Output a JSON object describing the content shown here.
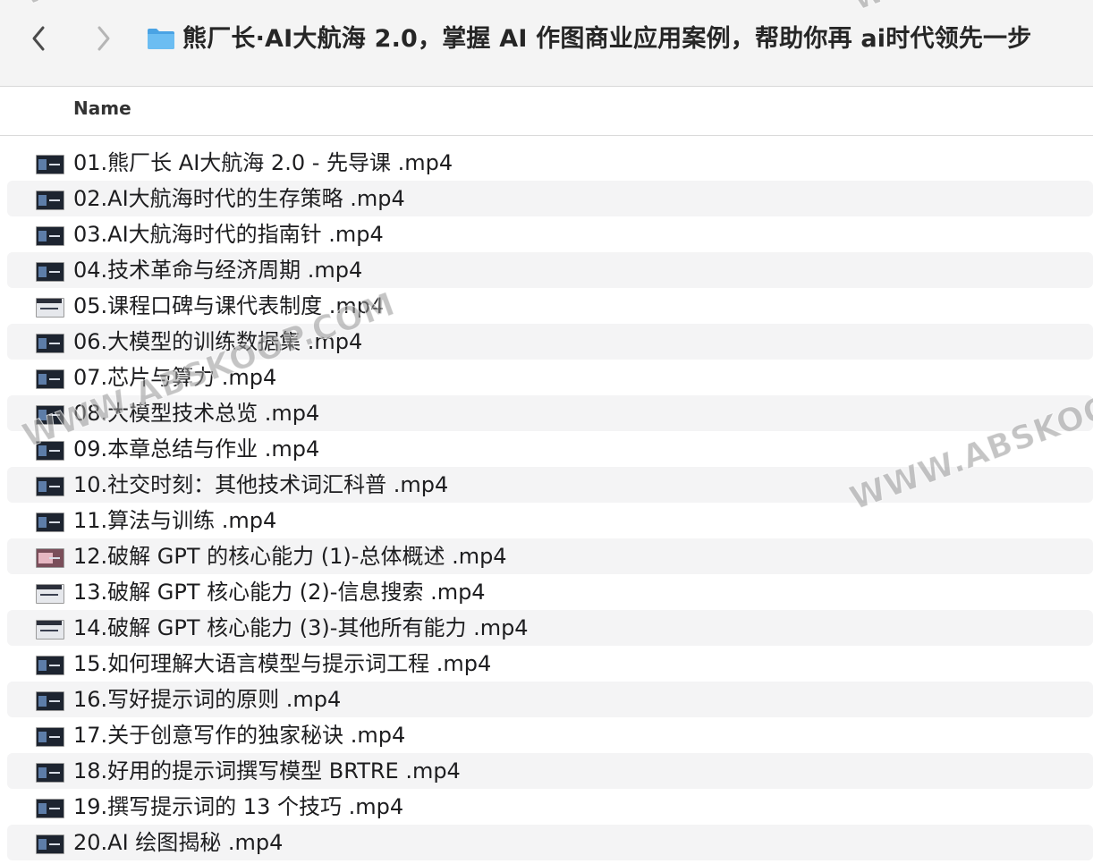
{
  "toolbar": {
    "title": "熊厂长·AI大航海 2.0，掌握 AI 作图商业应用案例，帮助你再 ai时代领先一步",
    "back_icon": "chevron-left-icon",
    "forward_icon": "chevron-right-icon",
    "folder_icon": "folder-icon",
    "folder_color": "#5fb2ec"
  },
  "columns": {
    "name": "Name"
  },
  "files": [
    {
      "name": "01.熊厂长 AI大航海 2.0 - 先导课 .mp4",
      "thumb": "dark"
    },
    {
      "name": "02.AI大航海时代的生存策略 .mp4",
      "thumb": "dark"
    },
    {
      "name": "03.AI大航海时代的指南针 .mp4",
      "thumb": "dark"
    },
    {
      "name": "04.技术革命与经济周期 .mp4",
      "thumb": "dark"
    },
    {
      "name": "05.课程口碑与课代表制度 .mp4",
      "thumb": "light"
    },
    {
      "name": "06.大模型的训练数据集 .mp4",
      "thumb": "dark"
    },
    {
      "name": "07.芯片与算力 .mp4",
      "thumb": "dark"
    },
    {
      "name": "08.大模型技术总览 .mp4",
      "thumb": "dark"
    },
    {
      "name": "09.本章总结与作业 .mp4",
      "thumb": "dark"
    },
    {
      "name": "10.社交时刻：其他技术词汇科普 .mp4",
      "thumb": "dark"
    },
    {
      "name": "11.算法与训练 .mp4",
      "thumb": "dark"
    },
    {
      "name": "12.破解 GPT 的核心能力 (1)-总体概述 .mp4",
      "thumb": "pink"
    },
    {
      "name": "13.破解 GPT 核心能力 (2)-信息搜索 .mp4",
      "thumb": "light"
    },
    {
      "name": "14.破解 GPT 核心能力 (3)-其他所有能力 .mp4",
      "thumb": "light"
    },
    {
      "name": "15.如何理解大语言模型与提示词工程 .mp4",
      "thumb": "dark"
    },
    {
      "name": "16.写好提示词的原则 .mp4",
      "thumb": "dark"
    },
    {
      "name": "17.关于创意写作的独家秘诀 .mp4",
      "thumb": "dark"
    },
    {
      "name": "18.好用的提示词撰写模型 BRTRE .mp4",
      "thumb": "dark"
    },
    {
      "name": "19.撰写提示词的 13 个技巧 .mp4",
      "thumb": "dark"
    },
    {
      "name": "20.AI 绘图揭秘 .mp4",
      "thumb": "dark"
    }
  ],
  "watermarks": {
    "main": "WWW.ABSKOOP.COM",
    "right": "WWW.ABSKOO",
    "top_left": "WWW",
    "top_right": "WWW"
  }
}
